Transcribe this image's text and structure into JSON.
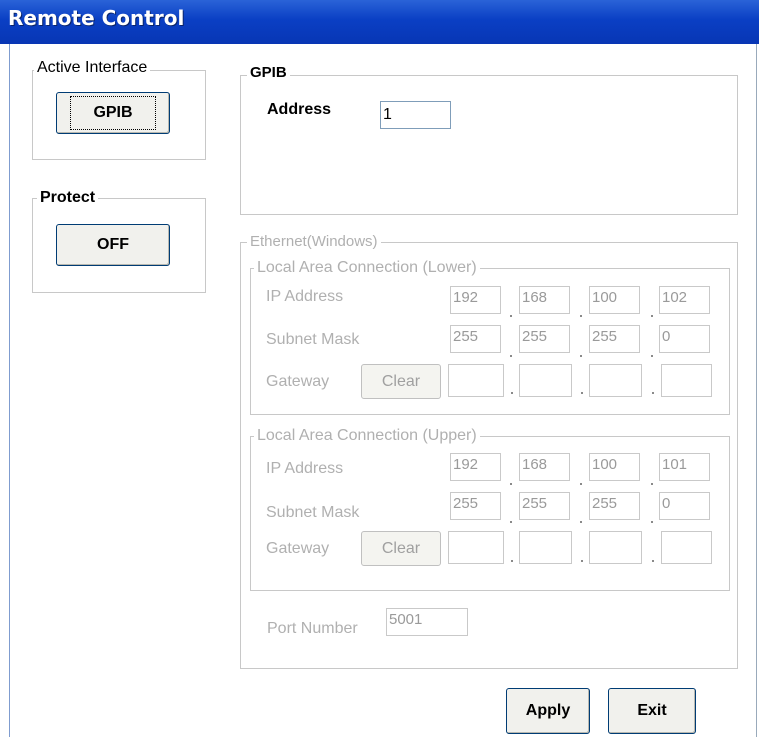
{
  "window": {
    "title": "Remote Control"
  },
  "active_interface": {
    "legend": "Active Interface",
    "button_label": "GPIB"
  },
  "protect": {
    "legend": "Protect",
    "button_label": "OFF"
  },
  "gpib": {
    "legend": "GPIB",
    "address_label": "Address",
    "address_value": "1"
  },
  "ethernet": {
    "legend": "Ethernet(Windows)",
    "lower": {
      "legend": "Local Area Connection (Lower)",
      "ip_label": "IP Address",
      "ip": [
        "192",
        "168",
        "100",
        "102"
      ],
      "mask_label": "Subnet Mask",
      "mask": [
        "255",
        "255",
        "255",
        "0"
      ],
      "gateway_label": "Gateway",
      "clear_label": "Clear",
      "gateway": [
        "",
        "",
        "",
        ""
      ]
    },
    "upper": {
      "legend": "Local Area Connection (Upper)",
      "ip_label": "IP Address",
      "ip": [
        "192",
        "168",
        "100",
        "101"
      ],
      "mask_label": "Subnet Mask",
      "mask": [
        "255",
        "255",
        "255",
        "0"
      ],
      "gateway_label": "Gateway",
      "clear_label": "Clear",
      "gateway": [
        "",
        "",
        "",
        ""
      ]
    },
    "port_label": "Port Number",
    "port_value": "5001"
  },
  "footer": {
    "apply_label": "Apply",
    "exit_label": "Exit"
  },
  "colors": {
    "titlebar": "#0a3fc4",
    "disabled_text": "#b0b0b0"
  }
}
